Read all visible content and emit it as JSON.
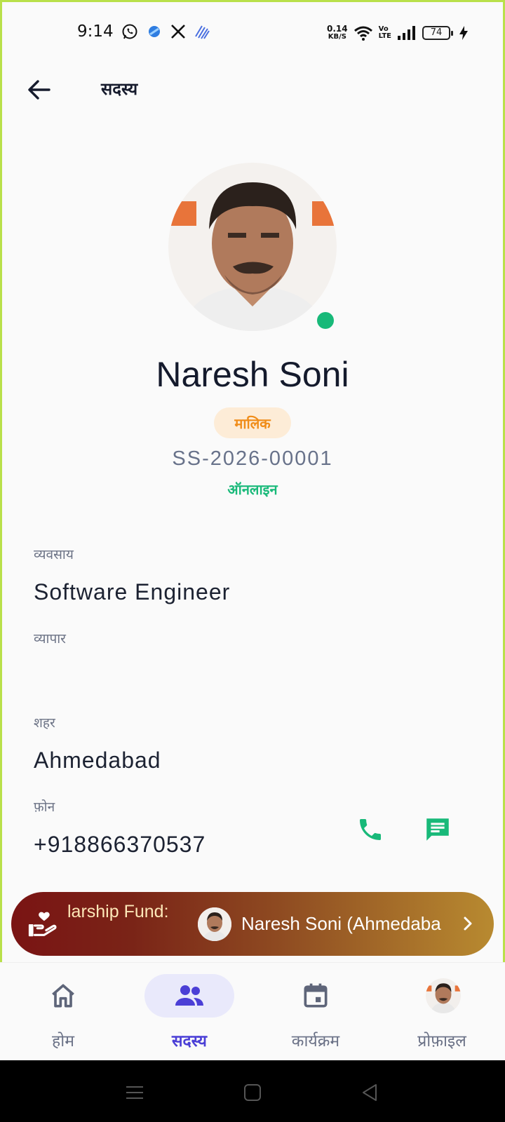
{
  "status_bar": {
    "time": "9:14",
    "net_speed_value": "0.14",
    "net_speed_unit": "KB/S",
    "volte_top": "Vo",
    "volte_bottom": "LTE",
    "battery": "74",
    "icons": [
      "whatsapp-icon",
      "blue-app-icon",
      "x-icon",
      "stripes-app-icon",
      "wifi-icon",
      "signal-icon",
      "charging-icon"
    ]
  },
  "app_bar": {
    "title": "सदस्य"
  },
  "profile": {
    "name": "Naresh Soni",
    "role": "मालिक",
    "member_id": "SS-2026-00001",
    "status": "ऑनलाइन",
    "online_color": "#18b979"
  },
  "fields": {
    "occupation_label": "व्यवसाय",
    "occupation_value": "Software Engineer",
    "business_label": "व्यापार",
    "business_value": "",
    "city_label": "शहर",
    "city_value": "Ahmedabad",
    "phone_label": "फ़ोन",
    "phone_value": "+918866370537"
  },
  "banner": {
    "title": "larship Fund:",
    "text": "Naresh Soni (Ahmedaba"
  },
  "bottom_nav": {
    "items": [
      {
        "label": "होम",
        "icon": "home-icon",
        "active": false
      },
      {
        "label": "सदस्य",
        "icon": "members-icon",
        "active": true
      },
      {
        "label": "कार्यक्रम",
        "icon": "calendar-icon",
        "active": false
      },
      {
        "label": "प्रोफ़ाइल",
        "icon": "profile-avatar",
        "active": false
      }
    ]
  },
  "colors": {
    "accent": "#4b3fd6",
    "green": "#18b979",
    "badge_text": "#f08c18",
    "badge_bg": "#fdecd7"
  }
}
